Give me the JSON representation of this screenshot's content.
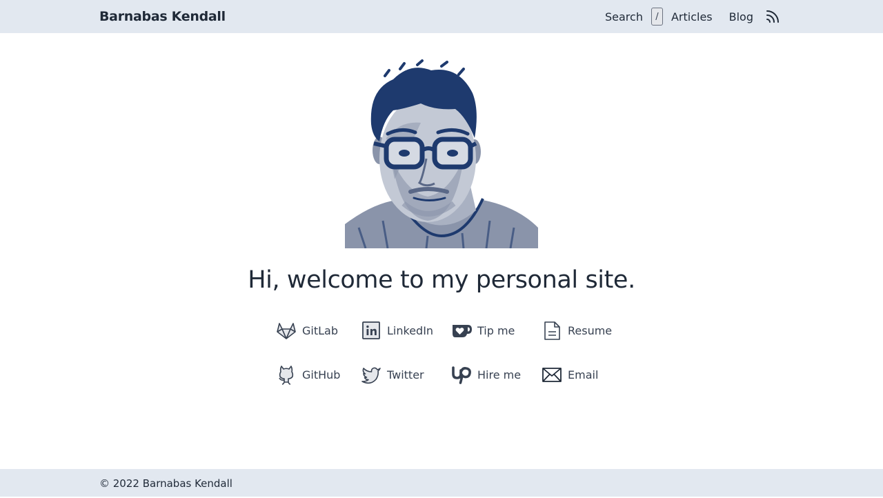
{
  "header": {
    "brand": "Barnabas Kendall",
    "nav": {
      "search_label": "Search",
      "search_shortcut": "/",
      "articles_label": "Articles",
      "blog_label": "Blog",
      "rss_icon": "rss-icon"
    }
  },
  "hero": {
    "avatar_icon": "portrait-photo",
    "welcome": "Hi, welcome to my personal site."
  },
  "links": [
    {
      "label": "GitLab",
      "icon": "gitlab-icon"
    },
    {
      "label": "LinkedIn",
      "icon": "linkedin-icon"
    },
    {
      "label": "Tip me",
      "icon": "kofi-cup-icon"
    },
    {
      "label": "Resume",
      "icon": "document-icon"
    },
    {
      "label": "GitHub",
      "icon": "github-icon"
    },
    {
      "label": "Twitter",
      "icon": "twitter-bird-icon"
    },
    {
      "label": "Hire me",
      "icon": "upwork-icon"
    },
    {
      "label": "Email",
      "icon": "envelope-icon"
    }
  ],
  "footer": {
    "copyright": "© 2022 Barnabas Kendall"
  },
  "colors": {
    "bar_background": "#e2e8f0",
    "text": "#1f2937",
    "link_text": "#374151",
    "portrait_blue": "#1e3a6e"
  }
}
